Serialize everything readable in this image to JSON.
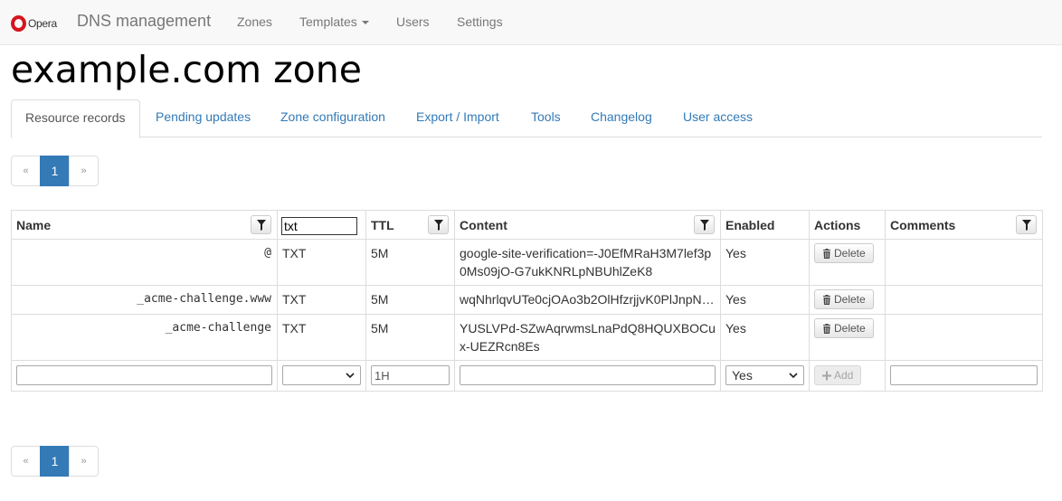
{
  "navbar": {
    "logo_text": "Opera",
    "brand": "DNS management",
    "links": [
      "Zones",
      "Templates",
      "Users",
      "Settings"
    ]
  },
  "page": {
    "title": "example.com zone"
  },
  "tabs": [
    {
      "label": "Resource records",
      "active": true
    },
    {
      "label": "Pending updates"
    },
    {
      "label": "Zone configuration"
    },
    {
      "label": "Export / Import"
    },
    {
      "label": "Tools"
    },
    {
      "label": "Changelog"
    },
    {
      "label": "User access"
    }
  ],
  "pagination": {
    "prev": "«",
    "current": "1",
    "next": "»"
  },
  "table": {
    "headers": {
      "name": "Name",
      "ttl": "TTL",
      "content": "Content",
      "enabled": "Enabled",
      "actions": "Actions",
      "comments": "Comments"
    },
    "type_filter_value": "txt",
    "rows": [
      {
        "name": "@",
        "type": "TXT",
        "ttl": "5M",
        "content": "google-site-verification=-J0EfMRaH3M7lef3p0Ms09jO-G7ukKNRLpNBUhlZeK8",
        "enabled": "Yes",
        "action": "Delete",
        "comment": ""
      },
      {
        "name": "_acme-challenge.www",
        "type": "TXT",
        "ttl": "5M",
        "content": "wqNhrlqvUTe0cjOAo3b2OlHfzrjjvK0PlJnpN…",
        "enabled": "Yes",
        "action": "Delete",
        "comment": ""
      },
      {
        "name": "_acme-challenge",
        "type": "TXT",
        "ttl": "5M",
        "content": "YUSLVPd-SZwAqrwmsLnaPdQ8HQUXBOCux-UEZRcn8Es",
        "enabled": "Yes",
        "action": "Delete",
        "comment": ""
      }
    ],
    "new_row": {
      "name": "",
      "type": "",
      "ttl": "1H",
      "content": "",
      "enabled": "Yes",
      "action": "Add",
      "comment": ""
    }
  }
}
